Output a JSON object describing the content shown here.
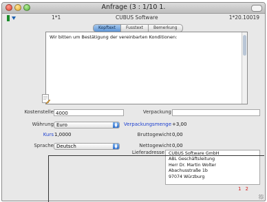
{
  "window": {
    "title": "Anfrage (3 : 1/10 1."
  },
  "infobar": {
    "record_no": "1*1",
    "company": "CUBUS Software",
    "date": "1*20.10019"
  },
  "tabs": [
    {
      "label": "Kopftext",
      "active": true
    },
    {
      "label": "Fusstext",
      "active": false
    },
    {
      "label": "Bemerkung",
      "active": false
    }
  ],
  "panel": {
    "text": "Wir bitten um Bestätigung der vereinbarten Konditionen:"
  },
  "form": {
    "kostenstelle": {
      "label": "Kostenstelle",
      "value": "4000"
    },
    "waehrung": {
      "label": "Währung",
      "value": "Euro"
    },
    "kurs": {
      "label": "Kurs",
      "value": "1,0000"
    },
    "sprache": {
      "label": "Sprache",
      "value": "Deutsch"
    },
    "verpackung": {
      "label": "Verpackung",
      "value": ""
    },
    "verpackungsmenge": {
      "label": "Verpackungsmenge",
      "value": "+3,00"
    },
    "bruttogewicht": {
      "label": "Bruttogewicht",
      "value": "0,00"
    },
    "nettogewicht": {
      "label": "Nettogewicht",
      "value": "0,00"
    },
    "lieferadresse": {
      "label": "Lieferadresse",
      "lines": [
        "CUBUS Software GmbH",
        "ABL Geschäftsleitung",
        "Herr Dr. Martin Wolter",
        "Abachusstraße 1b",
        "97074 Würzburg"
      ]
    }
  },
  "pages": [
    "1",
    "2"
  ],
  "colors": {
    "link_blue": "#1c3fd0",
    "page_red": "#d51b1b",
    "tab_active": "#5d95d6"
  }
}
